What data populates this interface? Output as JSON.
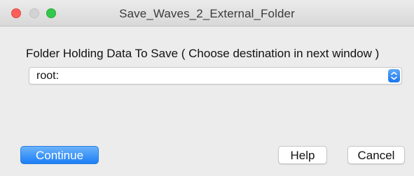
{
  "window": {
    "title": "Save_Waves_2_External_Folder",
    "controls": {
      "close_color": "#fc5f57",
      "minimize_color": "#d3d3d3",
      "zoom_color": "#34c84a"
    }
  },
  "dialog": {
    "prompt": "Folder Holding Data To Save ( Choose destination in next window )",
    "folder_popup": {
      "selected_value": "root:",
      "icon": "chevron-up-down-icon",
      "accent_color": "#1a76ee"
    }
  },
  "buttons": {
    "continue_label": "Continue",
    "help_label": "Help",
    "cancel_label": "Cancel",
    "default_color": "#1b7ef5"
  }
}
